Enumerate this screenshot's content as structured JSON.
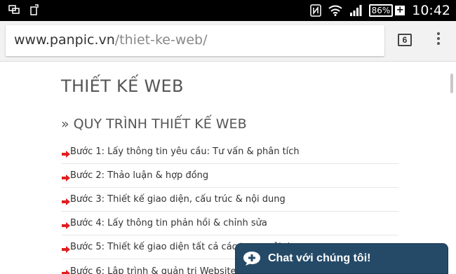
{
  "status_bar": {
    "left_icons": [
      "screen-mirror-icon",
      "phone-rotate-icon"
    ],
    "right_icons": [
      "nfc-icon",
      "wifi-icon",
      "signal-icon"
    ],
    "battery_percent": "86%",
    "time": "10:42"
  },
  "browser": {
    "url_host": "www.panpic.vn",
    "url_path": "/thiet-ke-web/",
    "tab_count": "6"
  },
  "page": {
    "title": "THIẾT KẾ WEB",
    "section_title": "» QUY TRÌNH THIẾT KẾ WEB",
    "steps": [
      "Bước 1: Lấy thông tin yêu cầu: Tư vấn & phân tích",
      "Bước 2: Thảo luận & hợp đồng",
      "Bước 3: Thiết kế giao diện, cấu trúc & nội dung",
      "Bước 4: Lấy thông tin phản hồi & chỉnh sửa",
      "Bước 5: Thiết kế giao diện tất cả các trang nội dung",
      "Bước 6: Lập trình & quản trị Website"
    ]
  },
  "chat": {
    "label": "Chat với chúng tôi!",
    "background": "#254a68"
  },
  "colors": {
    "arrow": "#e02020",
    "status_bar": "#000000"
  }
}
